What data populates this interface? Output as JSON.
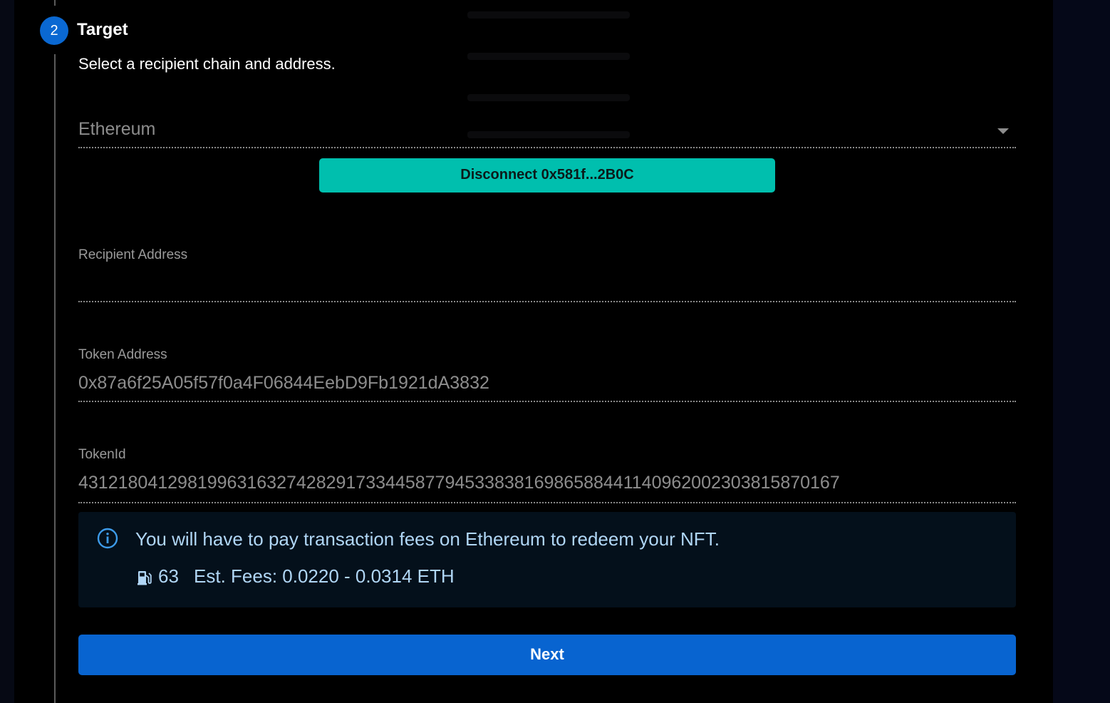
{
  "step": {
    "number": "2",
    "title": "Target",
    "description": "Select a recipient chain and address."
  },
  "chain_select": {
    "value": "Ethereum"
  },
  "wallet": {
    "disconnect_label": "Disconnect 0x581f...2B0C"
  },
  "recipient": {
    "label": "Recipient Address",
    "value": ""
  },
  "token_address": {
    "label": "Token Address",
    "value": "0x87a6f25A05f57f0a4F06844EebD9Fb1921dA3832"
  },
  "token_id": {
    "label": "TokenId",
    "value": "43121804129819963163274282917334458779453383816986588441140962002303815870167"
  },
  "fee_notice": {
    "message": "You will have to pay transaction fees on Ethereum to redeem your NFT.",
    "gas_price": "63",
    "estimate": "Est. Fees: 0.0220 - 0.0314 ETH",
    "icon_info": "info-icon",
    "icon_gas": "gas-pump-icon"
  },
  "actions": {
    "next_label": "Next"
  },
  "colors": {
    "accent_blue": "#0864d0",
    "teal": "#00bfae",
    "info_text": "#b0d6f5"
  }
}
